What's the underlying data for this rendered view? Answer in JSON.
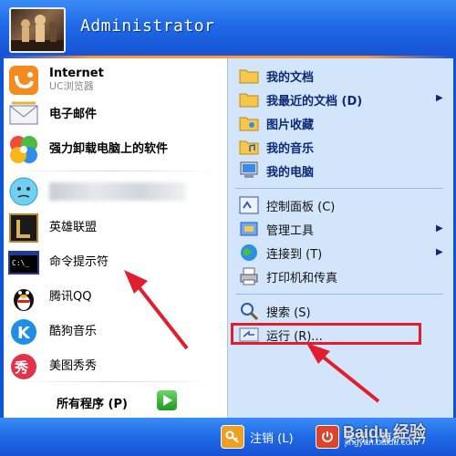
{
  "user": {
    "name": "Administrator"
  },
  "left_items": [
    {
      "id": "internet",
      "title": "Internet",
      "subtitle": "UC浏览器",
      "icon": "uc-browser-icon"
    },
    {
      "id": "email",
      "title": "电子邮件",
      "icon": "mail-icon"
    },
    {
      "id": "uninstall",
      "title": "强力卸载电脑上的软件",
      "icon": "pinwheel-icon"
    },
    {
      "id": "qq-blur",
      "title": "",
      "icon": "smiley-icon"
    },
    {
      "id": "lol",
      "title": "英雄联盟",
      "icon": "lol-icon"
    },
    {
      "id": "cmd",
      "title": "命令提示符",
      "icon": "cmd-icon"
    },
    {
      "id": "qq",
      "title": "腾讯QQ",
      "icon": "penguin-icon"
    },
    {
      "id": "kugou",
      "title": "酷狗音乐",
      "icon": "kugou-icon"
    },
    {
      "id": "meitu",
      "title": "美图秀秀",
      "icon": "meitu-icon"
    }
  ],
  "all_programs": {
    "label": "所有程序 (P)",
    "icon": "green-arrow-icon"
  },
  "right_items": [
    {
      "id": "docs",
      "label": "我的文档",
      "icon": "folder-icon",
      "bold": true
    },
    {
      "id": "recent",
      "label": "我最近的文档 (D)",
      "icon": "folder-icon",
      "bold": true,
      "more": "▶"
    },
    {
      "id": "pictures",
      "label": "图片收藏",
      "icon": "folder-icon",
      "bold": true
    },
    {
      "id": "music",
      "label": "我的音乐",
      "icon": "folder-icon",
      "bold": true
    },
    {
      "id": "computer",
      "label": "我的电脑",
      "icon": "computer-icon",
      "bold": true
    },
    {
      "id": "control",
      "label": "控制面板 (C)",
      "icon": "control-panel-icon",
      "bold": false
    },
    {
      "id": "admin",
      "label": "管理工具",
      "icon": "admin-tools-icon",
      "bold": false,
      "more": "▶"
    },
    {
      "id": "connect",
      "label": "连接到 (T)",
      "icon": "globe-icon",
      "bold": false,
      "more": "▶"
    },
    {
      "id": "printers",
      "label": "打印机和传真",
      "icon": "printer-icon",
      "bold": false
    },
    {
      "id": "search",
      "label": "搜索 (S)",
      "icon": "search-icon",
      "bold": false
    },
    {
      "id": "run",
      "label": "运行 (R)...",
      "icon": "run-icon",
      "bold": false
    }
  ],
  "footer": {
    "logoff": "注销 (L)",
    "shutdown": "关闭计算机 (U)"
  },
  "watermark": {
    "text": "Baidu 经验",
    "url": "jingyan.baidu.com"
  },
  "colors": {
    "xp_blue": "#1f69e6",
    "right_panel": "#d3e5fa",
    "highlight_red": "#e01e2e"
  }
}
